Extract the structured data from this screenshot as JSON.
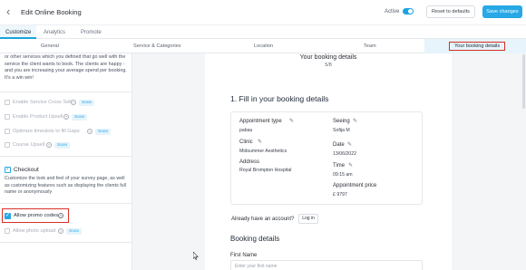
{
  "header": {
    "back_glyph": "‹",
    "title": "Edit Online Booking",
    "active_label": "Active",
    "active_on": true,
    "reset_label": "Reset to defaults",
    "save_label": "Save changes"
  },
  "primary_tabs": [
    "Customize",
    "Analytics",
    "Promote"
  ],
  "secondary_tabs": [
    "General",
    "Service & Categories",
    "Location",
    "Team",
    "Your booking details"
  ],
  "left": {
    "description": "or other services which you defined that go well with the service the client wants to book. The clients are happy - and you are increasing your average spend per booking. It's a win win!",
    "options": [
      {
        "label": "Enable Service Cross Sell",
        "badge": "Soon"
      },
      {
        "label": "Enable Product Upsell",
        "badge": "Soon"
      },
      {
        "label": "Optimize timeslots to fill Gaps",
        "badge": "Soon"
      },
      {
        "label": "Course Upsell",
        "badge": "Soon"
      }
    ],
    "checkout": {
      "title": "Checkout",
      "description": "Customize the look and feel of your survey page, as well as customizing features such as displaying the clients full name or anonymously"
    },
    "promo_label": "Allow promo codes",
    "photo_label": "Allow photo upload",
    "photo_badge": "Soon"
  },
  "preview": {
    "title": "Your booking details",
    "step": "5/8",
    "fill_heading": "1. Fill in your booking details",
    "appointment_type_label": "Appointment type",
    "appointment_type_value": "pabau",
    "seeing_label": "Seeing",
    "seeing_value": "Sofija M",
    "clinic_label": "Clinic",
    "clinic_value": "Midsummer Aesthetics",
    "date_label": "Date",
    "date_value": "13/06/2022",
    "address_label": "Address",
    "address_value": "Royal Brompton Hospital",
    "time_label": "Time",
    "time_value": "09:15 am",
    "price_label": "Appointment price",
    "price_value": "£ 9797",
    "account_question": "Already have an account?",
    "login_label": "Log in",
    "booking_details_heading": "Booking details",
    "first_name_label": "First Name",
    "first_name_placeholder": "Enter your first name"
  },
  "colors": {
    "accent": "#27a9e5",
    "highlight_box": "#d93025"
  }
}
